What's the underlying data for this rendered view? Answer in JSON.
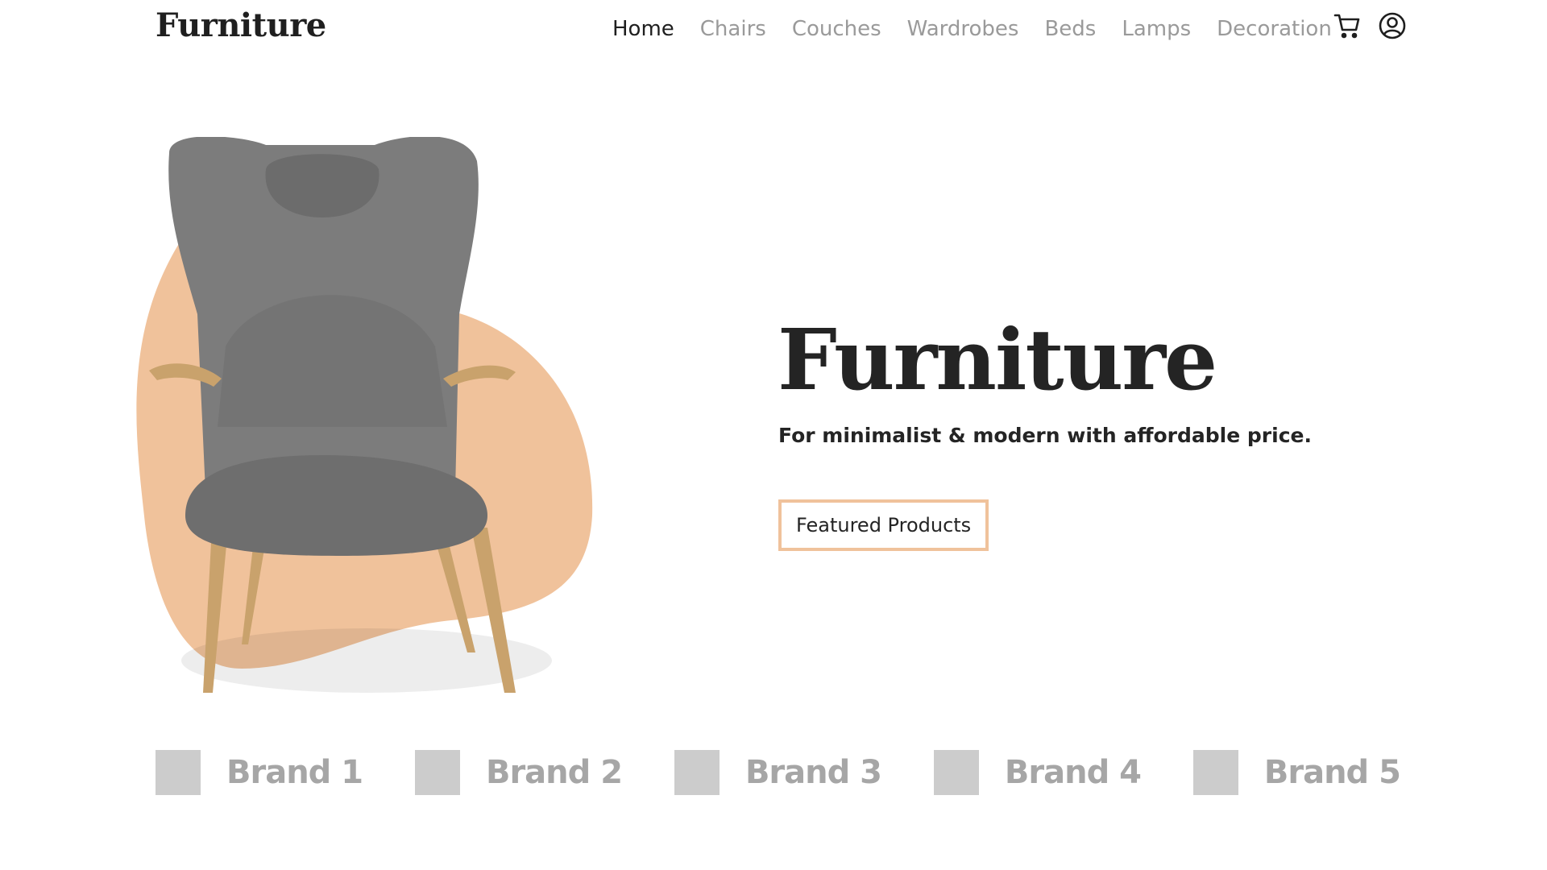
{
  "header": {
    "logo": "Furniture",
    "nav": [
      {
        "label": "Home",
        "active": true
      },
      {
        "label": "Chairs",
        "active": false
      },
      {
        "label": "Couches",
        "active": false
      },
      {
        "label": "Wardrobes",
        "active": false
      },
      {
        "label": "Beds",
        "active": false
      },
      {
        "label": "Lamps",
        "active": false
      },
      {
        "label": "Decoration",
        "active": false
      }
    ],
    "icons": [
      "cart-icon",
      "user-account-icon"
    ]
  },
  "hero": {
    "title": "Furniture",
    "subtitle": "For minimalist & modern with affordable price.",
    "cta_label": "Featured Products",
    "image": "grey-wingback-armchair"
  },
  "brands": [
    {
      "name": "Brand 1"
    },
    {
      "name": "Brand 2"
    },
    {
      "name": "Brand 3"
    },
    {
      "name": "Brand 4"
    },
    {
      "name": "Brand 5"
    }
  ],
  "colors": {
    "accent": "#f0c29b",
    "text_dark": "#242424",
    "nav_muted": "#9a9a9a",
    "brand_text": "#a6a6a6",
    "brand_placeholder": "#cccccc",
    "chair_fabric": "#7c7c7c",
    "chair_wood": "#c9a26c"
  }
}
